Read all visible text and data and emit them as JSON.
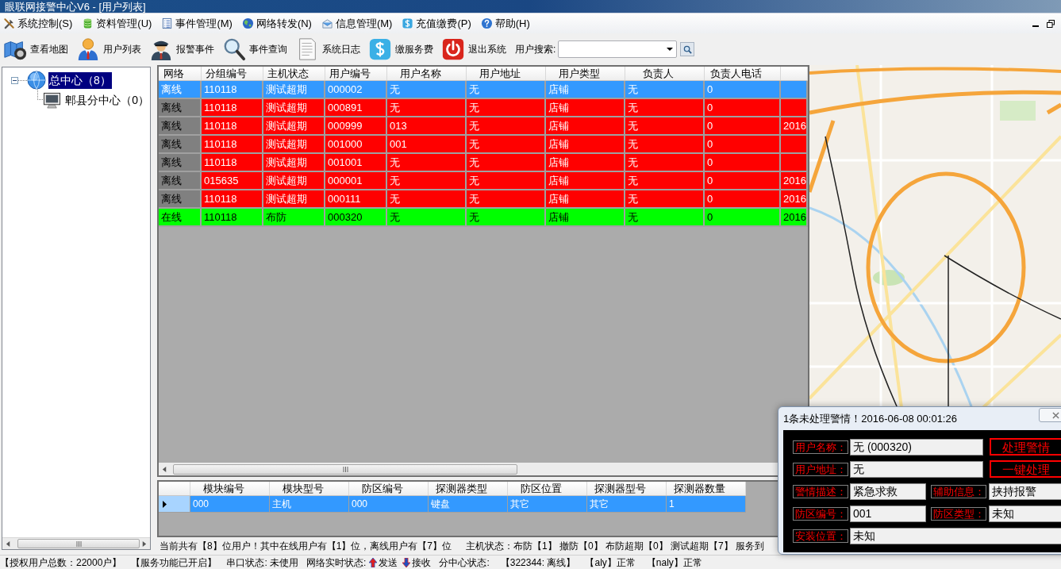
{
  "window": {
    "title": "眼联网接警中心V6 - [用户列表]"
  },
  "menu": [
    "系统控制(S)",
    "资料管理(U)",
    "事件管理(M)",
    "网络转发(N)",
    "信息管理(M)",
    "充值缴费(P)",
    "帮助(H)"
  ],
  "toolbar": {
    "buttons": [
      "查看地图",
      "用户列表",
      "报警事件",
      "事件查询",
      "系统日志",
      "缴服务费",
      "退出系统"
    ],
    "search_label": "用户搜索:"
  },
  "tree": [
    {
      "label": "总中心（8）",
      "selected": true,
      "expanded": true,
      "children": [
        {
          "label": "郫县分中心（0）",
          "selected": false
        }
      ]
    }
  ],
  "user_table": {
    "columns": [
      "网络",
      "分组编号",
      "主机状态",
      "用户编号",
      "用户名称",
      "用户地址",
      "用户类型",
      "负责人",
      "负责人电话"
    ],
    "rows": [
      {
        "selected": true,
        "online": false,
        "cells": [
          "离线",
          "110118",
          "测试超期",
          "000002",
          "无",
          "无",
          "店铺",
          "无",
          "0"
        ]
      },
      {
        "selected": false,
        "online": false,
        "cells": [
          "离线",
          "110118",
          "测试超期",
          "000891",
          "无",
          "无",
          "店铺",
          "无",
          "0"
        ]
      },
      {
        "selected": false,
        "online": false,
        "cells": [
          "离线",
          "110118",
          "测试超期",
          "000999",
          "013",
          "无",
          "店铺",
          "无",
          "0",
          "2016"
        ]
      },
      {
        "selected": false,
        "online": false,
        "cells": [
          "离线",
          "110118",
          "测试超期",
          "001000",
          "001",
          "无",
          "店铺",
          "无",
          "0"
        ]
      },
      {
        "selected": false,
        "online": false,
        "cells": [
          "离线",
          "110118",
          "测试超期",
          "001001",
          "无",
          "无",
          "店铺",
          "无",
          "0"
        ]
      },
      {
        "selected": false,
        "online": false,
        "cells": [
          "离线",
          "015635",
          "测试超期",
          "000001",
          "无",
          "无",
          "店铺",
          "无",
          "0",
          "2016"
        ]
      },
      {
        "selected": false,
        "online": false,
        "cells": [
          "离线",
          "110118",
          "测试超期",
          "000111",
          "无",
          "无",
          "店铺",
          "无",
          "0",
          "2016"
        ]
      },
      {
        "selected": false,
        "online": true,
        "cells": [
          "在线",
          "110118",
          "布防",
          "000320",
          "无",
          "无",
          "店铺",
          "无",
          "0",
          "2016"
        ]
      }
    ]
  },
  "module_table": {
    "columns": [
      "模块编号",
      "模块型号",
      "防区编号",
      "探测器类型",
      "防区位置",
      "探测器型号",
      "探测器数量"
    ],
    "rows": [
      {
        "selected": true,
        "cells": [
          "000",
          "主机",
          "000",
          "键盘",
          "其它",
          "其它",
          "1"
        ]
      }
    ]
  },
  "status_line": {
    "summary": "当前共有【8】位用户！其中在线用户有【1】位，离线用户有【7】位",
    "host_status": "主机状态：布防【1】 撤防【0】 布防超期【0】 测试超期【7】 服务到"
  },
  "status_bar": {
    "license": "【授权用户总数：22000户】",
    "service": "【服务功能已开启】",
    "serial": "串口状态: 未使用",
    "network_label": "网络实时状态:",
    "send": "发送",
    "receive": "接收",
    "branch_label": "分中心状态:",
    "branch_value": "【322344: 离线】",
    "aly": "【aly】正常",
    "naly": "【naly】正常"
  },
  "alert_popup": {
    "title": "1条未处理警情！2016-06-08 00:01:26",
    "fields": [
      {
        "label": "用户名称：",
        "value": "无 (000320)"
      },
      {
        "label": "用户地址：",
        "value": "无"
      },
      {
        "label": "警情描述：",
        "value": "紧急求救"
      },
      {
        "label": "辅助信息：",
        "value": "挟持报警"
      },
      {
        "label": "防区编号：",
        "value": "001"
      },
      {
        "label": "防区类型：",
        "value": "未知"
      },
      {
        "label": "安装位置：",
        "value": "未知"
      }
    ],
    "buttons": [
      "处理警情",
      "一键处理"
    ]
  }
}
